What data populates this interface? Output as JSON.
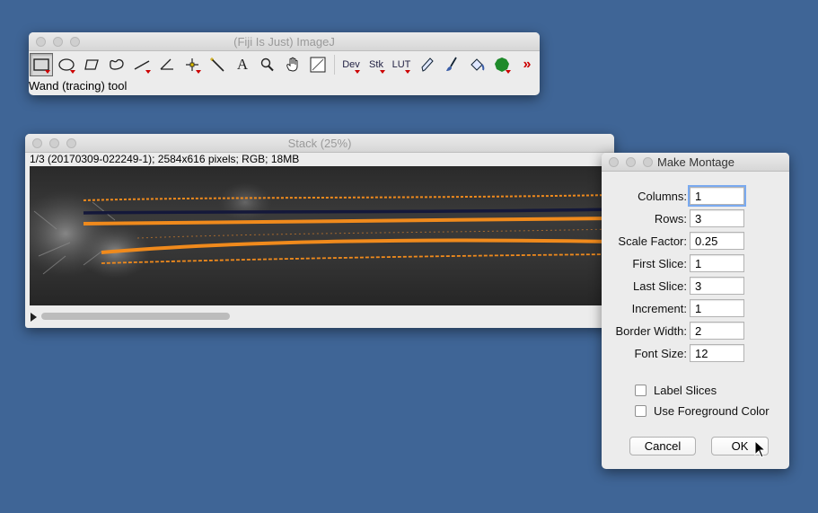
{
  "imagej": {
    "title": "(Fiji Is Just) ImageJ",
    "status": "Wand (tracing) tool",
    "tools": {
      "rectangle": "rectangle-tool-icon",
      "oval": "oval-tool-icon",
      "polygon": "polygon-tool-icon",
      "freehand": "freehand-tool-icon",
      "line": "line-tool-icon",
      "angle": "angle-tool-icon",
      "point": "point-tool-icon",
      "wand": "wand-tool-icon",
      "text": "A",
      "magnifier": "magnifier-tool-icon",
      "hand": "hand-tool-icon",
      "color_picker": "color-picker-tool-icon",
      "dev": "Dev",
      "stk": "Stk",
      "lut": "LUT",
      "pencil": "pencil-tool-icon",
      "brush": "brush-tool-icon",
      "flood_fill": "flood-fill-tool-icon",
      "blob": "blob-tool-icon",
      "more": "»"
    }
  },
  "stack": {
    "title": "Stack (25%)",
    "info": "1/3 (20170309-022249-1); 2584x616 pixels; RGB; 18MB"
  },
  "montage": {
    "title": "Make Montage",
    "fields": [
      {
        "label": "Columns:",
        "value": "1"
      },
      {
        "label": "Rows:",
        "value": "3"
      },
      {
        "label": "Scale Factor:",
        "value": "0.25"
      },
      {
        "label": "First Slice:",
        "value": "1"
      },
      {
        "label": "Last Slice:",
        "value": "3"
      },
      {
        "label": "Increment:",
        "value": "1"
      },
      {
        "label": "Border Width:",
        "value": "2"
      },
      {
        "label": "Font Size:",
        "value": "12"
      }
    ],
    "checkboxes": [
      {
        "label": "Label Slices",
        "checked": false
      },
      {
        "label": "Use Foreground Color",
        "checked": false
      }
    ],
    "cancel_label": "Cancel",
    "ok_label": "OK"
  },
  "colors": {
    "desktop": "#3f6596",
    "trace_orange": "#f08a1c",
    "trace_dark": "#14183a"
  }
}
